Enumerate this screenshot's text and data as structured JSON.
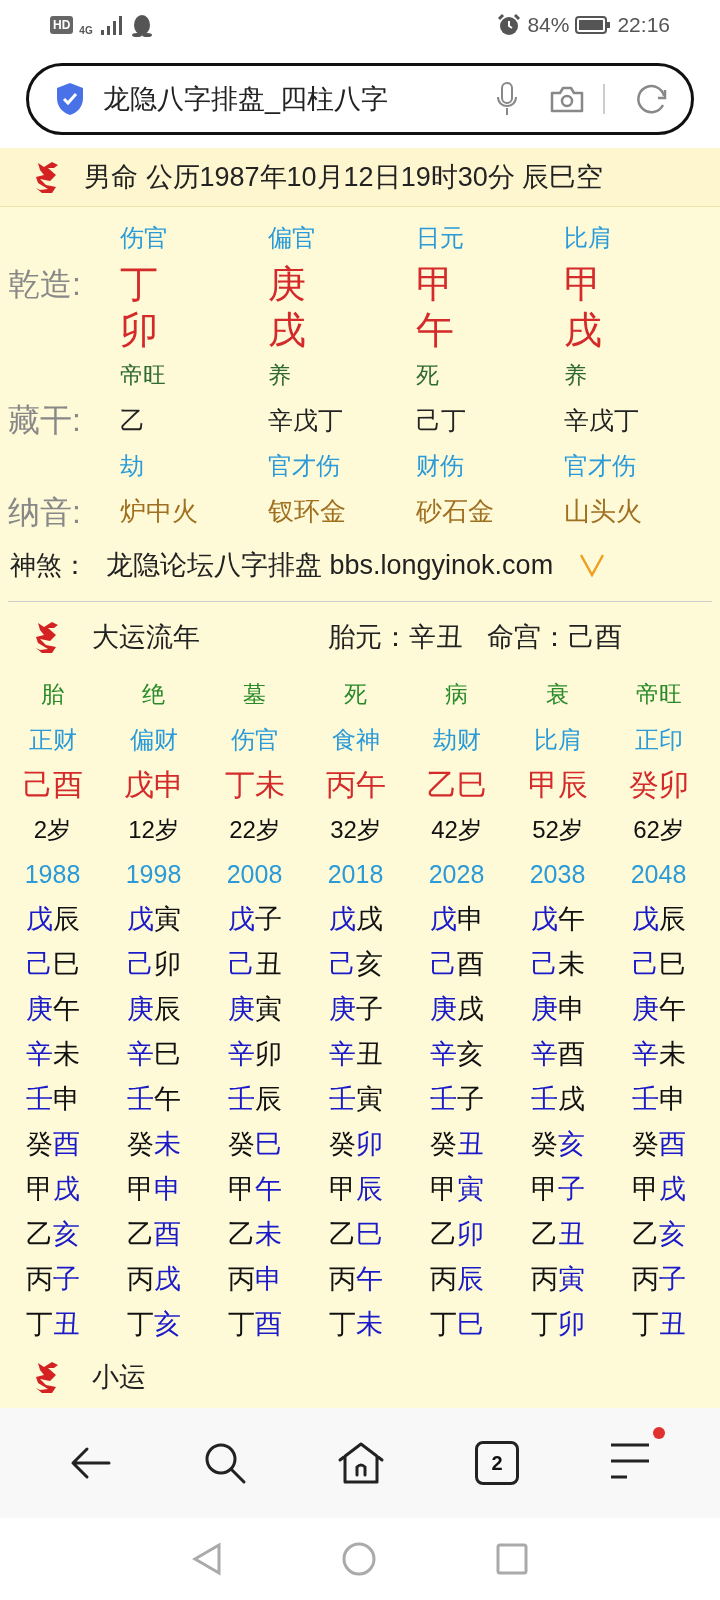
{
  "status_bar": {
    "hd": "HD",
    "network": "4G",
    "battery": "84%",
    "time": "22:16"
  },
  "address_bar": {
    "title": "龙隐八字排盘_四柱八字"
  },
  "header": {
    "text": "男命 公历1987年10月12日19时30分 辰巳空"
  },
  "pillars": {
    "row_labels": [
      "乾造:",
      "藏干:",
      "纳音:"
    ],
    "columns": [
      {
        "ten_god": "伤官",
        "stem": "丁",
        "branch": "卯",
        "stage": "帝旺",
        "hidden": "乙",
        "hidden_gods": "劫",
        "nayin": "炉中火"
      },
      {
        "ten_god": "偏官",
        "stem": "庚",
        "branch": "戌",
        "stage": "养",
        "hidden": "辛戊丁",
        "hidden_gods": "官才伤",
        "nayin": "钗环金"
      },
      {
        "ten_god": "日元",
        "stem": "甲",
        "branch": "午",
        "stage": "死",
        "hidden": "己丁",
        "hidden_gods": "财伤",
        "nayin": "砂石金"
      },
      {
        "ten_god": "比肩",
        "stem": "甲",
        "branch": "戌",
        "stage": "养",
        "hidden": "辛戊丁",
        "hidden_gods": "官才伤",
        "nayin": "山头火"
      }
    ]
  },
  "shensha": {
    "label": "神煞：",
    "text": "龙隐论坛八字排盘 bbs.longyinok.com"
  },
  "dayun": {
    "title": "大运流年",
    "taiyuan": "胎元：辛丑",
    "minggong": "命宫：己酉",
    "columns": [
      {
        "stage": "胎",
        "ten_god": "正财",
        "pillar": "己酉",
        "age": "2岁",
        "year": "1988",
        "years": [
          {
            "stem": "戊",
            "branch": "辰",
            "stem_accented": true
          },
          {
            "stem": "己",
            "branch": "巳",
            "stem_accented": true
          },
          {
            "stem": "庚",
            "branch": "午",
            "stem_accented": true
          },
          {
            "stem": "辛",
            "branch": "未",
            "stem_accented": true
          },
          {
            "stem": "壬",
            "branch": "申",
            "stem_accented": true
          },
          {
            "stem": "癸",
            "branch": "酉",
            "stem_accented": false
          },
          {
            "stem": "甲",
            "branch": "戌",
            "stem_accented": false
          },
          {
            "stem": "乙",
            "branch": "亥",
            "stem_accented": false
          },
          {
            "stem": "丙",
            "branch": "子",
            "stem_accented": false
          },
          {
            "stem": "丁",
            "branch": "丑",
            "stem_accented": false
          }
        ]
      },
      {
        "stage": "绝",
        "ten_god": "偏财",
        "pillar": "戊申",
        "age": "12岁",
        "year": "1998",
        "years": [
          {
            "stem": "戊",
            "branch": "寅",
            "stem_accented": true
          },
          {
            "stem": "己",
            "branch": "卯",
            "stem_accented": true
          },
          {
            "stem": "庚",
            "branch": "辰",
            "stem_accented": true
          },
          {
            "stem": "辛",
            "branch": "巳",
            "stem_accented": true
          },
          {
            "stem": "壬",
            "branch": "午",
            "stem_accented": true
          },
          {
            "stem": "癸",
            "branch": "未",
            "stem_accented": false
          },
          {
            "stem": "甲",
            "branch": "申",
            "stem_accented": false
          },
          {
            "stem": "乙",
            "branch": "酉",
            "stem_accented": false
          },
          {
            "stem": "丙",
            "branch": "戌",
            "stem_accented": false
          },
          {
            "stem": "丁",
            "branch": "亥",
            "stem_accented": false
          }
        ]
      },
      {
        "stage": "墓",
        "ten_god": "伤官",
        "pillar": "丁未",
        "age": "22岁",
        "year": "2008",
        "years": [
          {
            "stem": "戊",
            "branch": "子",
            "stem_accented": true
          },
          {
            "stem": "己",
            "branch": "丑",
            "stem_accented": true
          },
          {
            "stem": "庚",
            "branch": "寅",
            "stem_accented": true
          },
          {
            "stem": "辛",
            "branch": "卯",
            "stem_accented": true
          },
          {
            "stem": "壬",
            "branch": "辰",
            "stem_accented": true
          },
          {
            "stem": "癸",
            "branch": "巳",
            "stem_accented": false
          },
          {
            "stem": "甲",
            "branch": "午",
            "stem_accented": false
          },
          {
            "stem": "乙",
            "branch": "未",
            "stem_accented": false
          },
          {
            "stem": "丙",
            "branch": "申",
            "stem_accented": false
          },
          {
            "stem": "丁",
            "branch": "酉",
            "stem_accented": false
          }
        ]
      },
      {
        "stage": "死",
        "ten_god": "食神",
        "pillar": "丙午",
        "age": "32岁",
        "year": "2018",
        "years": [
          {
            "stem": "戊",
            "branch": "戌",
            "stem_accented": true
          },
          {
            "stem": "己",
            "branch": "亥",
            "stem_accented": true
          },
          {
            "stem": "庚",
            "branch": "子",
            "stem_accented": true
          },
          {
            "stem": "辛",
            "branch": "丑",
            "stem_accented": true
          },
          {
            "stem": "壬",
            "branch": "寅",
            "stem_accented": true
          },
          {
            "stem": "癸",
            "branch": "卯",
            "stem_accented": false
          },
          {
            "stem": "甲",
            "branch": "辰",
            "stem_accented": false
          },
          {
            "stem": "乙",
            "branch": "巳",
            "stem_accented": false
          },
          {
            "stem": "丙",
            "branch": "午",
            "stem_accented": false
          },
          {
            "stem": "丁",
            "branch": "未",
            "stem_accented": false
          }
        ]
      },
      {
        "stage": "病",
        "ten_god": "劫财",
        "pillar": "乙巳",
        "age": "42岁",
        "year": "2028",
        "years": [
          {
            "stem": "戊",
            "branch": "申",
            "stem_accented": true
          },
          {
            "stem": "己",
            "branch": "酉",
            "stem_accented": true
          },
          {
            "stem": "庚",
            "branch": "戌",
            "stem_accented": true
          },
          {
            "stem": "辛",
            "branch": "亥",
            "stem_accented": true
          },
          {
            "stem": "壬",
            "branch": "子",
            "stem_accented": true
          },
          {
            "stem": "癸",
            "branch": "丑",
            "stem_accented": false
          },
          {
            "stem": "甲",
            "branch": "寅",
            "stem_accented": false
          },
          {
            "stem": "乙",
            "branch": "卯",
            "stem_accented": false
          },
          {
            "stem": "丙",
            "branch": "辰",
            "stem_accented": false
          },
          {
            "stem": "丁",
            "branch": "巳",
            "stem_accented": false
          }
        ]
      },
      {
        "stage": "衰",
        "ten_god": "比肩",
        "pillar": "甲辰",
        "age": "52岁",
        "year": "2038",
        "years": [
          {
            "stem": "戊",
            "branch": "午",
            "stem_accented": true
          },
          {
            "stem": "己",
            "branch": "未",
            "stem_accented": true
          },
          {
            "stem": "庚",
            "branch": "申",
            "stem_accented": true
          },
          {
            "stem": "辛",
            "branch": "酉",
            "stem_accented": true
          },
          {
            "stem": "壬",
            "branch": "戌",
            "stem_accented": true
          },
          {
            "stem": "癸",
            "branch": "亥",
            "stem_accented": false
          },
          {
            "stem": "甲",
            "branch": "子",
            "stem_accented": false
          },
          {
            "stem": "乙",
            "branch": "丑",
            "stem_accented": false
          },
          {
            "stem": "丙",
            "branch": "寅",
            "stem_accented": false
          },
          {
            "stem": "丁",
            "branch": "卯",
            "stem_accented": false
          }
        ]
      },
      {
        "stage": "帝旺",
        "ten_god": "正印",
        "pillar": "癸卯",
        "age": "62岁",
        "year": "2048",
        "years": [
          {
            "stem": "戊",
            "branch": "辰",
            "stem_accented": true
          },
          {
            "stem": "己",
            "branch": "巳",
            "stem_accented": true
          },
          {
            "stem": "庚",
            "branch": "午",
            "stem_accented": true
          },
          {
            "stem": "辛",
            "branch": "未",
            "stem_accented": true
          },
          {
            "stem": "壬",
            "branch": "申",
            "stem_accented": true
          },
          {
            "stem": "癸",
            "branch": "酉",
            "stem_accented": false
          },
          {
            "stem": "甲",
            "branch": "戌",
            "stem_accented": false
          },
          {
            "stem": "乙",
            "branch": "亥",
            "stem_accented": false
          },
          {
            "stem": "丙",
            "branch": "子",
            "stem_accented": false
          },
          {
            "stem": "丁",
            "branch": "丑",
            "stem_accented": false
          }
        ]
      }
    ]
  },
  "xiaoyun": {
    "title": "小运"
  },
  "bottom_nav": {
    "tab_count": "2",
    "menu_badge": true
  }
}
